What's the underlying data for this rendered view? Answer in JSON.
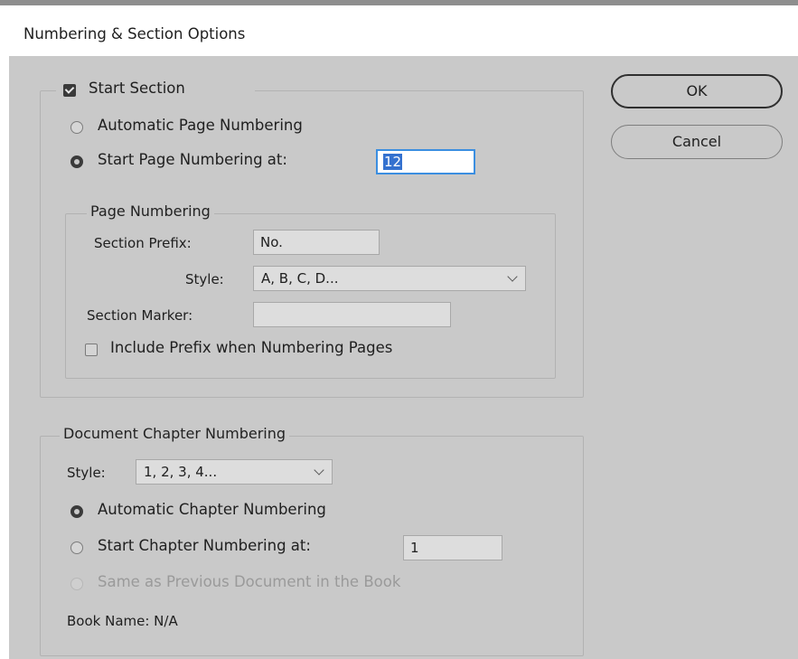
{
  "dialog": {
    "title": "Numbering & Section Options"
  },
  "buttons": {
    "ok": "OK",
    "cancel": "Cancel"
  },
  "section": {
    "start_section_label": "Start Section",
    "start_section_checked": true,
    "automatic_page_numbering_label": "Automatic Page Numbering",
    "start_page_numbering_label": "Start Page Numbering at:",
    "start_page_numbering_value": "12",
    "selected_option": "start_page_numbering"
  },
  "page_numbering": {
    "legend": "Page Numbering",
    "section_prefix_label": "Section Prefix:",
    "section_prefix_value": "No.",
    "style_label": "Style:",
    "style_value": "A, B, C, D...",
    "section_marker_label": "Section Marker:",
    "section_marker_value": "",
    "include_prefix_label": "Include Prefix when Numbering Pages",
    "include_prefix_checked": false
  },
  "chapter_numbering": {
    "legend": "Document Chapter Numbering",
    "style_label": "Style:",
    "style_value": "1, 2, 3, 4...",
    "automatic_label": "Automatic Chapter Numbering",
    "start_at_label": "Start Chapter Numbering at:",
    "start_at_value": "1",
    "same_as_previous_label": "Same as Previous Document in the Book",
    "selected_option": "automatic",
    "book_name_label": "Book Name: N/A"
  }
}
